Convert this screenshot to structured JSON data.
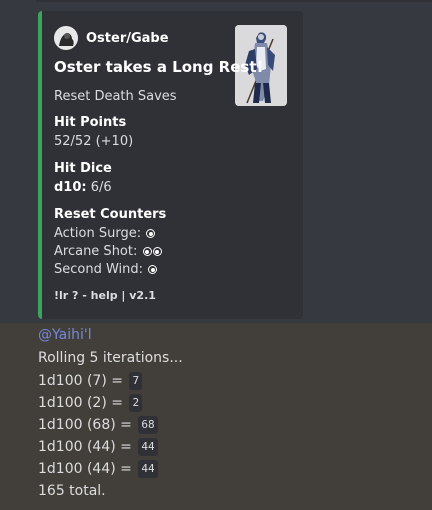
{
  "embed": {
    "accent_color": "#3ba55d",
    "author": "Oster/Gabe",
    "title": "Oster takes a Long Rest!",
    "description": "Reset Death Saves",
    "fields": [
      {
        "name": "Hit Points",
        "value": "52/52 (+10)"
      },
      {
        "name": "Hit Dice",
        "value_bold": "d10:",
        "value": "6/6"
      },
      {
        "name": "Reset Counters"
      }
    ],
    "counters": [
      {
        "label": "Action Surge:",
        "pips": 1
      },
      {
        "label": "Arcane Shot:",
        "pips": 2
      },
      {
        "label": "Second Wind:",
        "pips": 1
      }
    ],
    "footer": "!lr ? - help | v2.1"
  },
  "message": {
    "mention": "@Yaihi'l",
    "intro": "Rolling 5 iterations...",
    "rolls": [
      {
        "expr": "1d100 (7) =",
        "result": "7"
      },
      {
        "expr": "1d100 (2) =",
        "result": "2"
      },
      {
        "expr": "1d100 (68) =",
        "result": "68"
      },
      {
        "expr": "1d100 (44) =",
        "result": "44"
      },
      {
        "expr": "1d100 (44) =",
        "result": "44"
      }
    ],
    "total": "165 total."
  }
}
